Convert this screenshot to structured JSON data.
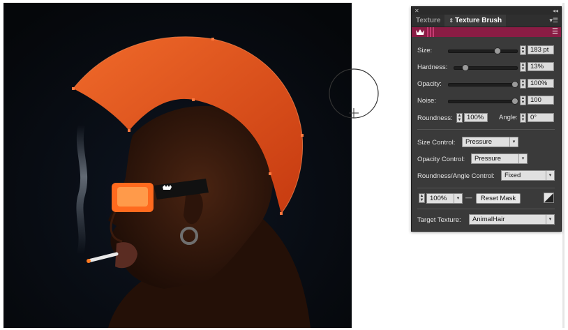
{
  "panel": {
    "tabs": [
      {
        "label": "Texture",
        "active": false
      },
      {
        "label": "Texture Brush",
        "active": true
      }
    ],
    "controls": {
      "size": {
        "label": "Size:",
        "value": "183 pt",
        "level": 0.72
      },
      "hardness": {
        "label": "Hardness:",
        "value": "13%",
        "level": 0.13
      },
      "opacity": {
        "label": "Opacity:",
        "value": "100%",
        "level": 1.0
      },
      "noise": {
        "label": "Noise:",
        "value": "100",
        "level": 1.0
      },
      "roundness": {
        "label": "Roundness:",
        "value": "100%"
      },
      "angle": {
        "label": "Angle:",
        "value": "0°"
      }
    },
    "size_control": {
      "label": "Size Control:",
      "value": "Pressure"
    },
    "opacity_control": {
      "label": "Opacity Control:",
      "value": "Pressure"
    },
    "roundness_angle_control": {
      "label": "Roundness/Angle Control:",
      "value": "Fixed"
    },
    "mask": {
      "percent": "100%",
      "dash": "—",
      "reset_label": "Reset Mask"
    },
    "target_texture": {
      "label": "Target Texture:",
      "value": "AnimalHair"
    }
  },
  "icons": {
    "close": "close-icon",
    "collapse": "double-chevron-icon",
    "menu": "hamburger-menu-icon",
    "preset": "crown-icon",
    "brush_cursor": "circle-brush-cursor-icon"
  },
  "colors": {
    "preset_bar": "#8a1c44",
    "hair": "#e8541d",
    "glasses": "#ff6a1e",
    "panel_bg": "#3a3a3a"
  }
}
